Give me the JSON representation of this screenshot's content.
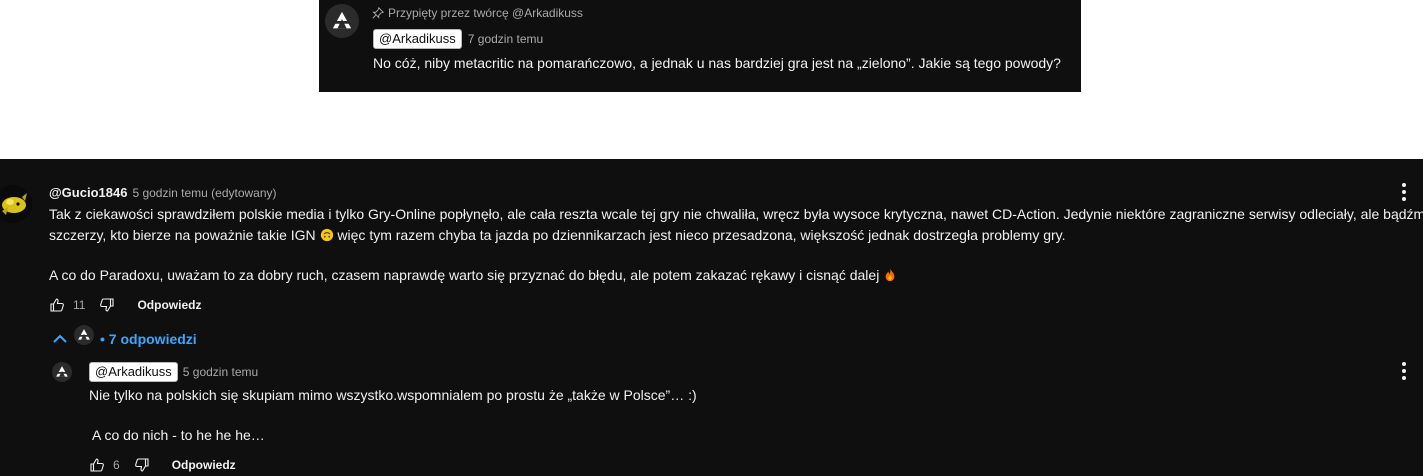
{
  "pinned": {
    "pinned_label": "Przypięty przez twórcę @Arkadikuss",
    "author": "@Arkadikuss",
    "time": "7 godzin temu",
    "text": "No cóż, niby metacritic na pomarańczowo, a jednak u nas bardziej gra jest na „zielono”. Jakie są tego powody?"
  },
  "comment": {
    "author": "@Gucio1846",
    "time": "5 godzin temu (edytowany)",
    "line1": "Tak z ciekawości sprawdziłem polskie media i tylko Gry-Online popłynęło, ale cała reszta wcale tej gry nie chwaliła, wręcz była wysoce krytyczna, nawet CD-Action. Jedynie niektóre zagraniczne serwisy odleciały, ale bądźmy",
    "line2a": "szczerzy, kto bierze na poważnie takie IGN",
    "line2b": "więc tym razem chyba ta jazda po dziennikarzach jest nieco przesadzona, większość jednak dostrzegła problemy gry.",
    "line3": "A co do Paradoxu, uważam to za dobry ruch, czasem naprawdę warto się przyznać do błędu, ale potem zakazać rękawy i cisnąć dalej",
    "likes": "11",
    "reply_label": "Odpowiedz",
    "replies_toggle": "• 7 odpowiedzi"
  },
  "reply": {
    "author": "@Arkadikuss",
    "time": "5 godzin temu",
    "line1": "Nie tylko na polskich się skupiam mimo wszystko.wspomnialem po prostu że „także w Polsce”… :)",
    "line2": "A co do nich - to he he he…",
    "likes": "6",
    "reply_label": "Odpowiedz"
  },
  "icons": [
    "pin-icon",
    "like-icon",
    "dislike-icon",
    "more-options-icon",
    "chevron-up-icon",
    "upside-down-face-emoji",
    "fire-emoji"
  ],
  "colors": {
    "background": "#0f0f0f",
    "text": "#f1f1f1",
    "muted": "#aaaaaa",
    "link": "#3ea6ff"
  }
}
